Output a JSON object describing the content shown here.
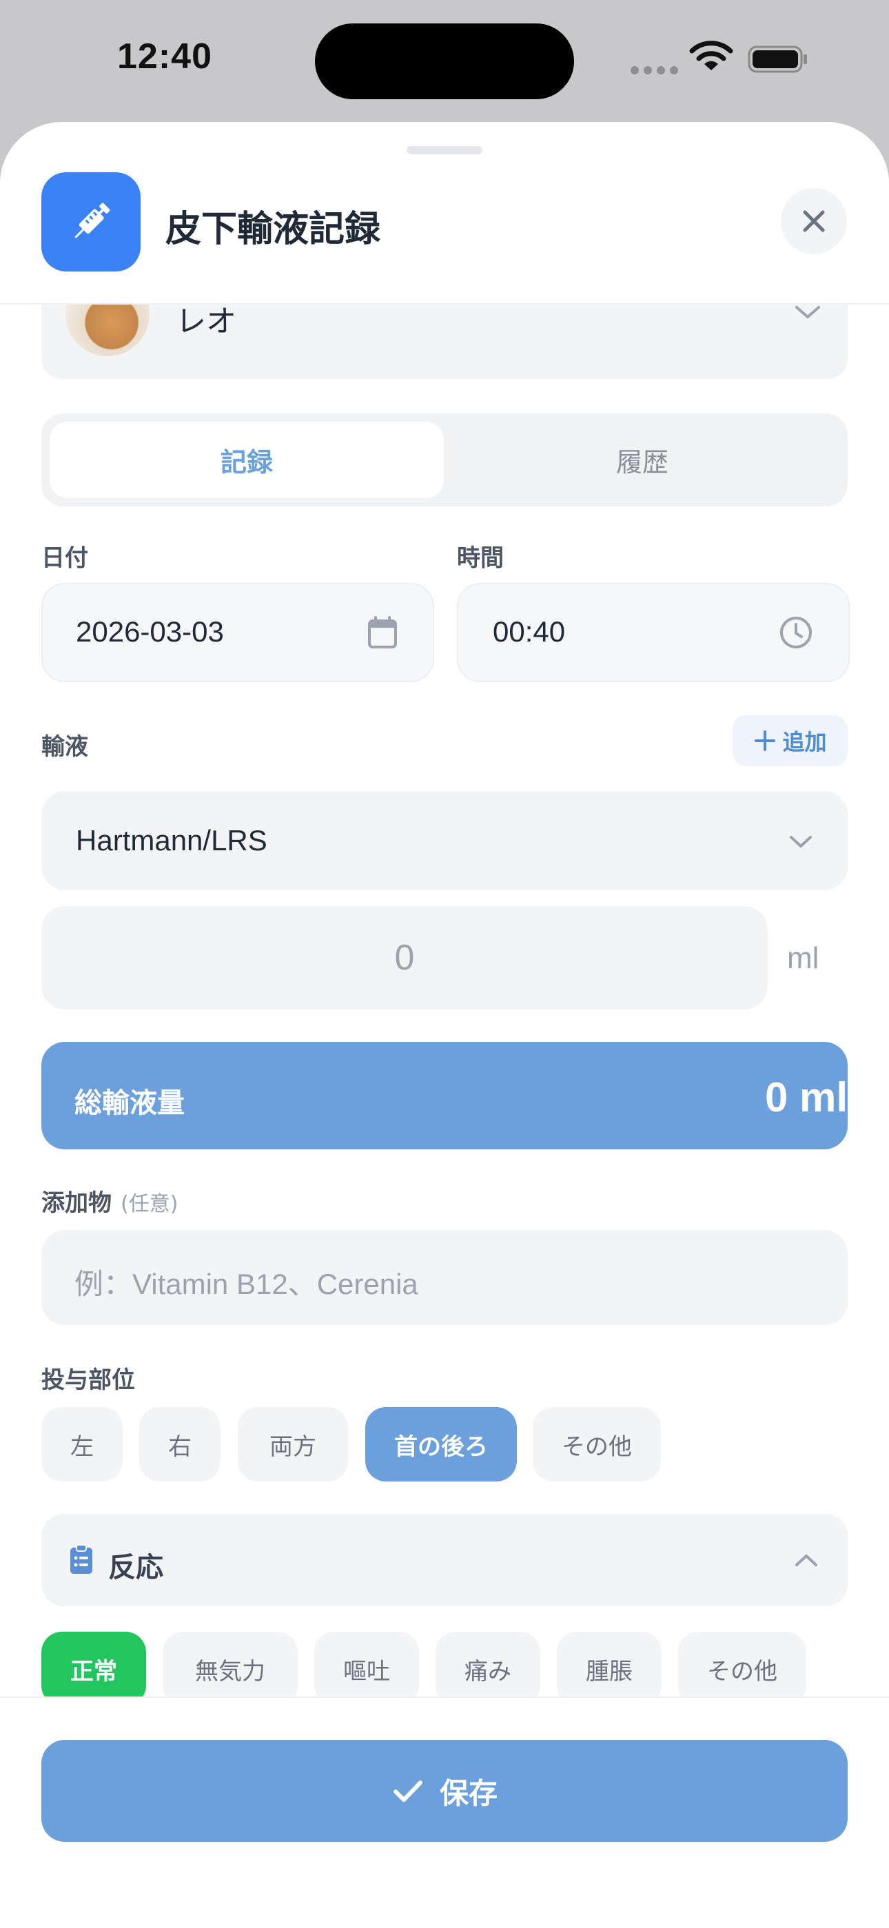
{
  "status_bar": {
    "time": "12:40"
  },
  "header": {
    "title": "皮下輸液記録",
    "icon": "syringe-icon",
    "close_icon": "close-icon"
  },
  "pet": {
    "name": "レオ"
  },
  "tabs": {
    "record": "記録",
    "history": "履歴",
    "active": "record"
  },
  "date": {
    "label": "日付",
    "value": "2026-03-03"
  },
  "time_field": {
    "label": "時間",
    "value": "00:40"
  },
  "fluid": {
    "label": "輸液",
    "add_label": "追加",
    "selected": "Hartmann/LRS",
    "amount": "0",
    "unit": "ml"
  },
  "total": {
    "label": "総輸液量",
    "value": "0 ml"
  },
  "additive": {
    "label": "添加物",
    "optional": "(任意)",
    "placeholder": "例：Vitamin B12、Cerenia"
  },
  "site": {
    "label": "投与部位",
    "options": [
      "左",
      "右",
      "両方",
      "首の後ろ",
      "その他"
    ],
    "selected": "首の後ろ"
  },
  "reaction": {
    "label": "反応",
    "options": [
      "正常",
      "無気力",
      "嘔吐",
      "痛み",
      "腫脹",
      "その他"
    ],
    "selected": "正常"
  },
  "save_label": "保存",
  "colors": {
    "accent": "#6ca0dc",
    "primary": "#3b82f6",
    "success": "#22c55e"
  }
}
